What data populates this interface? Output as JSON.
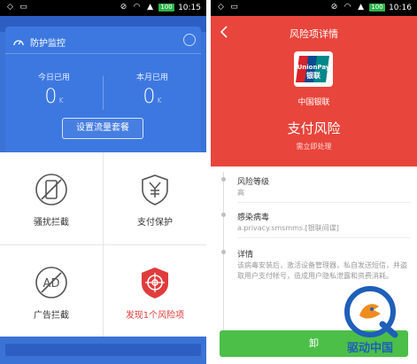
{
  "left": {
    "status_time": "10:15",
    "battery_pct": "100",
    "card_title": "防护监控",
    "today_label": "今日已用",
    "today_value": "0",
    "today_unit": "K",
    "month_label": "本月已用",
    "month_value": "0",
    "month_unit": "K",
    "plan_button": "设置流量套餐",
    "tiles": [
      {
        "label": "骚扰拦截",
        "icon": "phone-block-icon"
      },
      {
        "label": "支付保护",
        "icon": "yuan-shield-icon"
      },
      {
        "label": "广告拦截",
        "icon": "ad-block-icon"
      },
      {
        "label": "发现1个风险项",
        "icon": "risk-target-icon"
      }
    ],
    "colors": {
      "blue": "#3b72d6",
      "risk_red": "#e03c3c"
    }
  },
  "right": {
    "status_time": "10:16",
    "battery_pct": "100",
    "title": "风险项详情",
    "bank_name": "中国银联",
    "logo_text_top": "UnionPay",
    "logo_text_bottom": "银联",
    "risk_name": "支付风险",
    "risk_sub": "需立即处理",
    "level_title": "风险等级",
    "level_value": "高",
    "virus_title": "感染病毒",
    "virus_value": "a.privacy.smsmms.[银联间谍]",
    "detail_title": "详情",
    "detail_text": "该病毒安装后，激活设备管理器，私自发送短信，并盗取用户支付帐号，造成用户隐私泄露和资费消耗。",
    "action_button": "卸",
    "colors": {
      "red": "#e8453c",
      "green": "#4cbf49"
    }
  },
  "watermark": {
    "text": "驱动中国"
  }
}
